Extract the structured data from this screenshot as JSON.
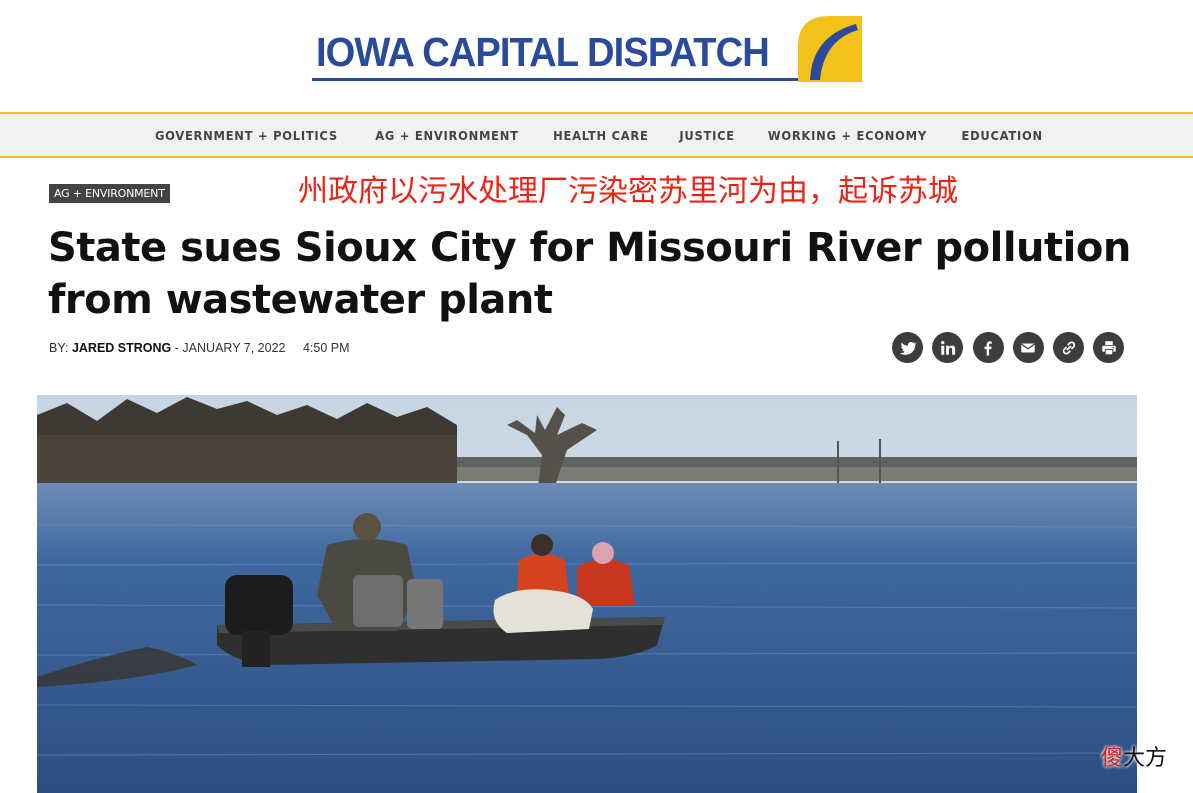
{
  "masthead": {
    "logo_text": "IOWA CAPITAL DISPATCH"
  },
  "nav": {
    "items": [
      {
        "label": "GOVERNMENT + POLITICS"
      },
      {
        "label": "AG + ENVIRONMENT"
      },
      {
        "label": "HEALTH CARE"
      },
      {
        "label": "JUSTICE"
      },
      {
        "label": "WORKING + ECONOMY"
      },
      {
        "label": "EDUCATION"
      }
    ]
  },
  "article": {
    "category": "AG + ENVIRONMENT",
    "chinese_title": "州政府以污水处理厂污染密苏里河为由，起诉苏城",
    "headline": "State sues Sioux City for Missouri River pollution from wastewater plant",
    "byline": {
      "prefix": "BY:",
      "author": "JARED STRONG",
      "separator": "-",
      "date": "JANUARY 7, 2022",
      "time": "4:50 PM"
    }
  },
  "share": {
    "icons": [
      "twitter-icon",
      "linkedin-icon",
      "facebook-icon",
      "email-icon",
      "link-icon",
      "print-icon"
    ]
  },
  "watermark": {
    "first_char": "傻",
    "rest": "大方"
  },
  "colors": {
    "brand_blue": "#2a4a9b",
    "brand_gold": "#f2c21b",
    "chinese_title_red": "#ee2216",
    "icon_dark": "#3d3d3d"
  }
}
